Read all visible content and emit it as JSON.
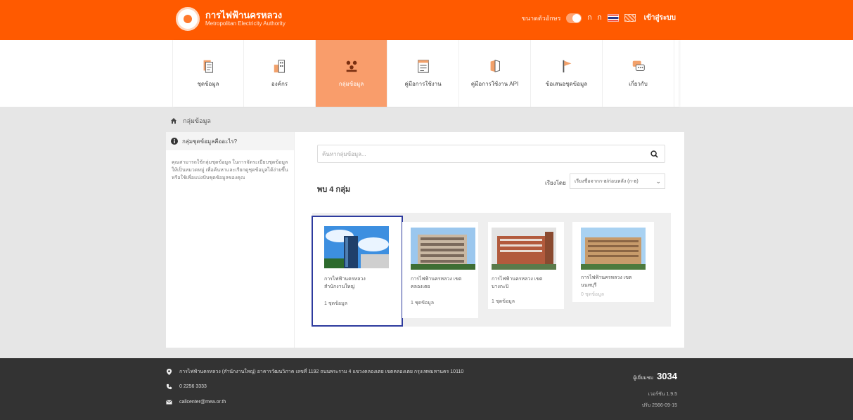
{
  "header": {
    "logo_title": "การไฟฟ้านครหลวง",
    "logo_subtitle": "Metropolitan Electricity Authority",
    "font_size_label": "ขนาดตัวอักษร",
    "font_small": "ก",
    "font_large": "ก",
    "login": "เข้าสู่ระบบ"
  },
  "nav": {
    "items": [
      {
        "label": "ชุดข้อมูล",
        "icon": "dataset-icon"
      },
      {
        "label": "องค์กร",
        "icon": "organization-icon"
      },
      {
        "label": "กลุ่มข้อมูล",
        "icon": "group-icon"
      },
      {
        "label": "คู่มือการใช้งาน",
        "icon": "manual-icon"
      },
      {
        "label": "คู่มือการใช้งาน API",
        "icon": "api-manual-icon"
      },
      {
        "label": "ข้อเสนอชุดข้อมูล",
        "icon": "suggest-icon"
      },
      {
        "label": "เกี่ยวกับ",
        "icon": "about-icon"
      }
    ],
    "active_index": 2
  },
  "breadcrumb": {
    "current": "กลุ่มข้อมูล"
  },
  "sidebar": {
    "title": "กลุ่มชุดข้อมูลคืออะไร?",
    "body": "คุณสามารถใช้กลุ่มชุดข้อมูล ในการจัดระเบียบชุดข้อมูลให้เป็นหมวดหมู่ เพื่อค้นหาและเรียกดูชุดข้อมูลได้ง่ายขึ้น หรือใช้เพื่อแบ่งปันชุดข้อมูลของคุณ"
  },
  "main": {
    "search_placeholder": "ค้นหากลุ่มข้อมูล...",
    "count_text": "พบ 4 กลุ่ม",
    "sort_label": "เรียงโดย",
    "sort_value": "เรียงชื่อจากก-ฮ/ก่อนหลัง (ก-ฮ)"
  },
  "cards": [
    {
      "title": "การไฟฟ้านครหลวง สำนักงานใหญ่",
      "count": "1 ชุดข้อมูล"
    },
    {
      "title": "การไฟฟ้านครหลวง เขตคลองเตย",
      "count": "1 ชุดข้อมูล"
    },
    {
      "title": "การไฟฟ้านครหลวง เขตบางกะปิ",
      "count": "1 ชุดข้อมูล"
    },
    {
      "title": "การไฟฟ้านครหลวง เขตนนทบุรี",
      "count": "0 ชุดข้อมูล"
    }
  ],
  "footer": {
    "address": "การไฟฟ้านครหลวง (สำนักงานใหญ่) อาคารวัฒนวิภาค เลขที่ 1192 ถนนพระราม 4 แขวงคลองเตย เขตคลองเตย กรุงเทพมหานคร 10110",
    "phone": "0 2256 3333",
    "email": "callcenter@mea.or.th",
    "visitors_label": "ผู้เยี่ยมชม",
    "visitors_count": "3034",
    "version": "เวอร์ชัน 1.9.5",
    "updated": "ปรับ 2566-09-15"
  },
  "colors": {
    "brand_orange": "#ff5a00",
    "nav_active": "#f99d6b",
    "footer_bg": "#333333",
    "selected_border": "#2e3b9e"
  }
}
